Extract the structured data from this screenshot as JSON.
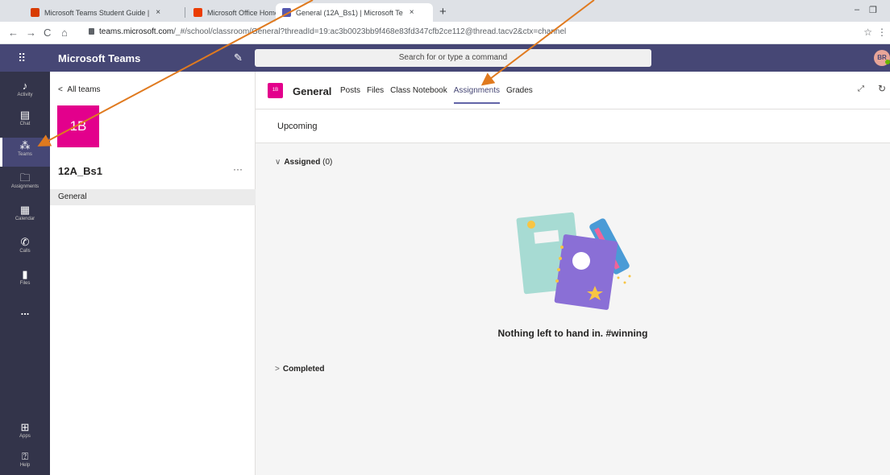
{
  "browser": {
    "tabs": [
      {
        "title": "Microsoft Teams Student Guide |",
        "close": "×",
        "favicon_color": "#d83b01"
      },
      {
        "title": "Microsoft Office Home",
        "close": "×",
        "favicon_color": "#eb3c00"
      },
      {
        "title": "General (12A_Bs1) | Microsoft Te",
        "close": "×",
        "favicon_color": "#5558af"
      }
    ],
    "new_tab": "+",
    "url_host": "teams.microsoft.com",
    "url_path": "/_#/school/classroom/General?threadId=19:ac3b0023bb9f468e83fd347cfb2ce112@thread.tacv2&ctx=channel"
  },
  "teams": {
    "app_title": "Microsoft Teams",
    "search_placeholder": "Search for or type a command",
    "user_initials": "BR"
  },
  "rail": [
    {
      "label": "Activity",
      "icon": "bell-icon"
    },
    {
      "label": "Chat",
      "icon": "chat-icon"
    },
    {
      "label": "Teams",
      "icon": "teams-icon",
      "active": true
    },
    {
      "label": "Assignments",
      "icon": "assignments-icon"
    },
    {
      "label": "Calendar",
      "icon": "calendar-icon"
    },
    {
      "label": "Calls",
      "icon": "phone-icon"
    },
    {
      "label": "Files",
      "icon": "file-icon"
    },
    {
      "label": "...",
      "icon": "more-icon"
    },
    {
      "label": "Apps",
      "icon": "apps-icon"
    },
    {
      "label": "Help",
      "icon": "help-icon"
    }
  ],
  "team_pane": {
    "back_label": "All teams",
    "tile_text": "1B",
    "team_name": "12A_Bs1",
    "more": "···",
    "channels": [
      "General"
    ]
  },
  "channel": {
    "tile_text": "1B",
    "name": "General",
    "tabs": [
      "Posts",
      "Files",
      "Class Notebook",
      "Assignments",
      "Grades"
    ],
    "active_tab": "Assignments"
  },
  "assignments": {
    "section_title": "Upcoming",
    "assigned_label": "Assigned",
    "assigned_count": "(0)",
    "empty_message": "Nothing left to hand in. #winning",
    "completed_label": "Completed"
  },
  "colors": {
    "header": "#464775",
    "rail": "#33344a",
    "accent": "#6264a7",
    "team_tile": "#e3008c",
    "annotation_arrow": "#e07a1f"
  }
}
